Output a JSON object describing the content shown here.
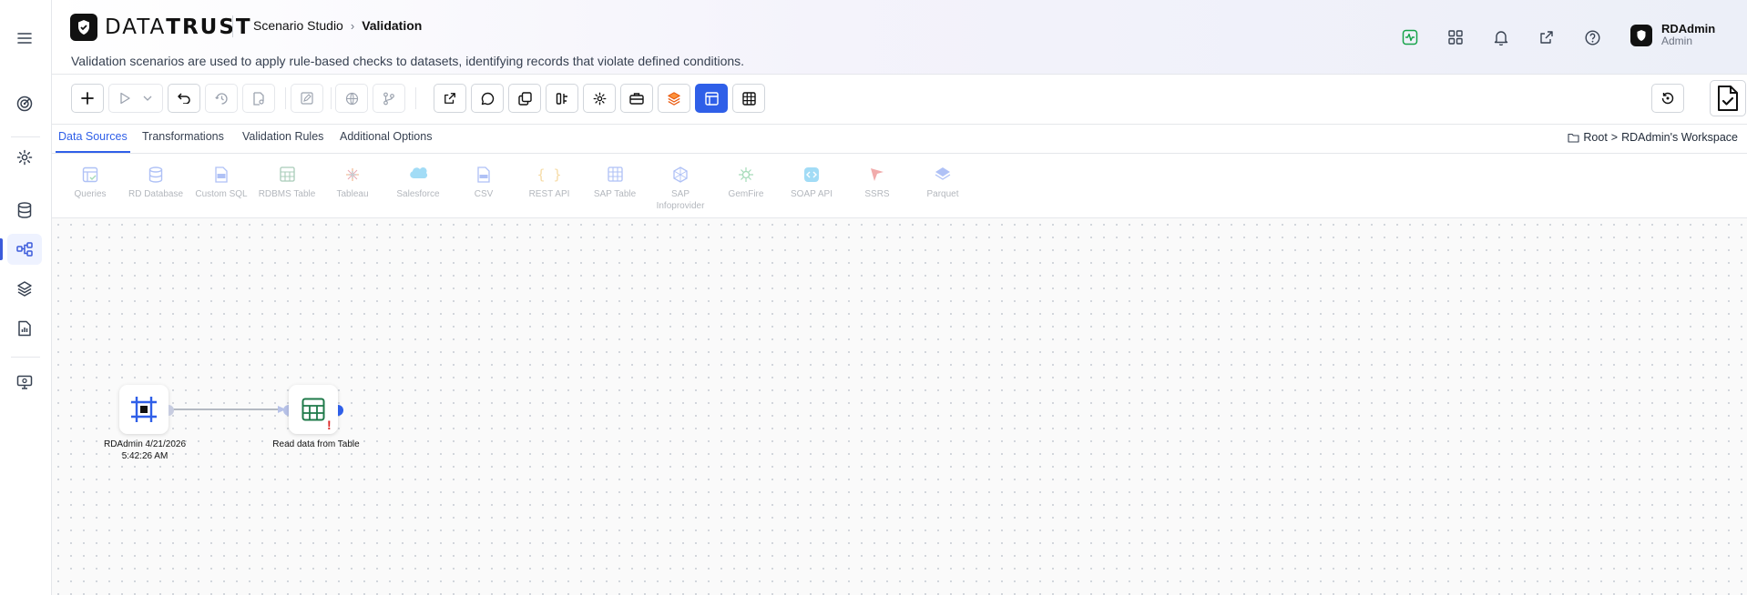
{
  "app": {
    "brand_prefix": "DATA",
    "brand_suffix": "TRUST",
    "breadcrumb_parent": "Scenario Studio",
    "breadcrumb_current": "Validation",
    "description": "Validation scenarios are used to apply rule-based checks to datasets, identifying records that violate defined conditions."
  },
  "user": {
    "name": "RDAdmin",
    "role": "Admin"
  },
  "tabs": [
    {
      "label": "Data Sources",
      "active": true
    },
    {
      "label": "Transformations",
      "active": false
    },
    {
      "label": "Validation Rules",
      "active": false
    },
    {
      "label": "Additional Options",
      "active": false
    }
  ],
  "workspace": {
    "root": "Root",
    "separator": ">",
    "name": "RDAdmin's Workspace"
  },
  "palette": [
    {
      "label": "Queries",
      "icon": "queries-icon"
    },
    {
      "label": "RD Database",
      "icon": "database-icon"
    },
    {
      "label": "Custom SQL",
      "icon": "sql-icon"
    },
    {
      "label": "RDBMS Table",
      "icon": "table-icon"
    },
    {
      "label": "Tableau",
      "icon": "tableau-icon"
    },
    {
      "label": "Salesforce",
      "icon": "salesforce-icon"
    },
    {
      "label": "CSV",
      "icon": "csv-icon"
    },
    {
      "label": "REST API",
      "icon": "rest-api-icon"
    },
    {
      "label": "SAP Table",
      "icon": "sap-table-icon"
    },
    {
      "label": "SAP Infoprovider",
      "icon": "sap-infoprovider-icon"
    },
    {
      "label": "GemFire",
      "icon": "gemfire-icon"
    },
    {
      "label": "SOAP API",
      "icon": "soap-api-icon"
    },
    {
      "label": "SSRS",
      "icon": "ssrs-icon"
    },
    {
      "label": "Parquet",
      "icon": "parquet-icon"
    }
  ],
  "nodes": [
    {
      "label": "RDAdmin 4/21/2026 5:42:26 AM",
      "icon": "scenario-start-icon",
      "status": "ok"
    },
    {
      "label": "Read data from Table",
      "icon": "table-icon",
      "status": "error",
      "status_mark": "!"
    }
  ],
  "colors": {
    "accent": "#2f5fe8",
    "error": "#dc2626",
    "node_icon": "#2f5fe8",
    "table_icon": "#1f7a4a",
    "health": "#16a34a"
  }
}
